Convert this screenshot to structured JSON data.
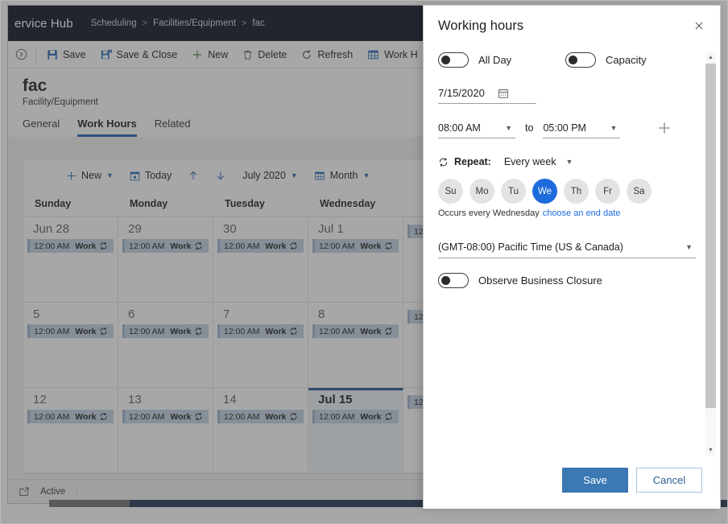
{
  "app": {
    "name": "ervice Hub",
    "breadcrumb": [
      "Scheduling",
      "Facilities/Equipment",
      "fac"
    ],
    "breadcrumb_separator": ">"
  },
  "ribbon": {
    "items": [
      {
        "label": "Save",
        "icon": "save-icon"
      },
      {
        "label": "Save & Close",
        "icon": "save-close-icon"
      },
      {
        "label": "New",
        "icon": "plus-icon"
      },
      {
        "label": "Delete",
        "icon": "trash-icon"
      },
      {
        "label": "Refresh",
        "icon": "refresh-icon"
      },
      {
        "label": "Work H",
        "icon": "grid-icon"
      }
    ]
  },
  "record": {
    "title": "fac",
    "subtitle": "Facility/Equipment",
    "tabs": [
      {
        "label": "General",
        "active": false
      },
      {
        "label": "Work Hours",
        "active": true
      },
      {
        "label": "Related",
        "active": false
      }
    ]
  },
  "calendar": {
    "toolbar": {
      "new_label": "New",
      "today_label": "Today",
      "prev_icon": "arrow-up-icon",
      "next_icon": "arrow-down-icon",
      "period_label": "July 2020",
      "view_label": "Month"
    },
    "columns": [
      "Sunday",
      "Monday",
      "Tuesday",
      "Wednesday",
      ""
    ],
    "event_time": "12:00 AM",
    "event_title": "Work",
    "weeks": [
      {
        "days": [
          {
            "label": "Jun 28",
            "selected": false,
            "has_event": true
          },
          {
            "label": "29",
            "selected": false,
            "has_event": true
          },
          {
            "label": "30",
            "selected": false,
            "has_event": true
          },
          {
            "label": "Jul 1",
            "selected": false,
            "has_event": true
          },
          {
            "label": "",
            "selected": false,
            "has_event": true
          }
        ]
      },
      {
        "days": [
          {
            "label": "5",
            "selected": false,
            "has_event": true
          },
          {
            "label": "6",
            "selected": false,
            "has_event": true
          },
          {
            "label": "7",
            "selected": false,
            "has_event": true
          },
          {
            "label": "8",
            "selected": false,
            "has_event": true
          },
          {
            "label": "",
            "selected": false,
            "has_event": true
          }
        ]
      },
      {
        "days": [
          {
            "label": "12",
            "selected": false,
            "has_event": true
          },
          {
            "label": "13",
            "selected": false,
            "has_event": true
          },
          {
            "label": "14",
            "selected": false,
            "has_event": true
          },
          {
            "label": "Jul 15",
            "selected": true,
            "has_event": true
          },
          {
            "label": "",
            "selected": false,
            "has_event": true
          }
        ]
      }
    ]
  },
  "statusbar": {
    "icon": "open-record-icon",
    "text": "Active"
  },
  "panel": {
    "title": "Working hours",
    "close_icon": "close-icon",
    "toggles": [
      {
        "name": "all-day",
        "label": "All Day",
        "on": false
      },
      {
        "name": "capacity",
        "label": "Capacity",
        "on": false
      }
    ],
    "date": {
      "value": "7/15/2020",
      "icon": "calendar-icon"
    },
    "time": {
      "start": "08:00 AM",
      "to_label": "to",
      "end": "05:00 PM",
      "add_icon": "plus-icon"
    },
    "repeat": {
      "icon": "recurrence-icon",
      "label": "Repeat:",
      "value": "Every week",
      "days": [
        {
          "label": "Su",
          "selected": false
        },
        {
          "label": "Mo",
          "selected": false
        },
        {
          "label": "Tu",
          "selected": false
        },
        {
          "label": "We",
          "selected": true
        },
        {
          "label": "Th",
          "selected": false
        },
        {
          "label": "Fr",
          "selected": false
        },
        {
          "label": "Sa",
          "selected": false
        }
      ],
      "occurrence_text": "Occurs every Wednesday",
      "end_date_link": "choose an end date"
    },
    "timezone": {
      "value": "(GMT-08:00) Pacific Time (US & Canada)"
    },
    "business_closure": {
      "label": "Observe Business Closure",
      "on": false
    },
    "footer": {
      "save_label": "Save",
      "cancel_label": "Cancel"
    }
  },
  "colors": {
    "accent_blue": "#1e6bdc",
    "primary_button": "#3b78b4",
    "topbar": "#0b1021",
    "tab_underline": "#2266b5",
    "event_bg": "#c3d3e4"
  }
}
